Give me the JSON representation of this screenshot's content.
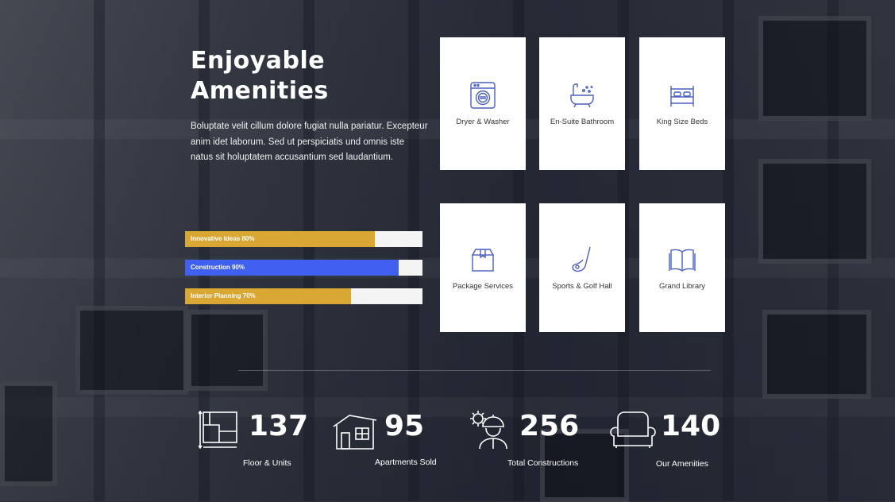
{
  "section": {
    "title_line1": "Enjoyable",
    "title_line2": "Amenities",
    "description": "Boluptate velit cillum dolore fugiat nulla pariatur. Excepteur anim idet laborum. Sed ut perspiciatis und omnis iste natus sit holuptatem accusantium sed laudantium."
  },
  "progress": [
    {
      "label": "Innovative Ideas 80%",
      "value": 0.8,
      "color": "#d9a733"
    },
    {
      "label": "Construction 90%",
      "value": 0.9,
      "color": "#4060f0"
    },
    {
      "label": "Interior Planning 70%",
      "value": 0.7,
      "color": "#d9a733"
    }
  ],
  "amenities": [
    {
      "label": "Dryer & Washer",
      "icon": "washing-machine-icon"
    },
    {
      "label": "En-Suite Bathroom",
      "icon": "bathtub-icon"
    },
    {
      "label": "King Size Beds",
      "icon": "bed-icon"
    },
    {
      "label": "Package Services",
      "icon": "package-box-icon"
    },
    {
      "label": "Sports & Golf Hall",
      "icon": "golf-club-icon"
    },
    {
      "label": "Grand Library",
      "icon": "open-book-icon"
    }
  ],
  "stats": [
    {
      "value": "137",
      "label": "Floor & Units",
      "icon": "floor-plan-icon"
    },
    {
      "value": "95",
      "label": "Apartments Sold",
      "icon": "house-icon"
    },
    {
      "value": "256",
      "label": "Total Constructions",
      "icon": "construction-worker-icon"
    },
    {
      "value": "140",
      "label": "Our Amenities",
      "icon": "armchair-icon"
    }
  ],
  "colors": {
    "accent_gold": "#d9a733",
    "accent_blue": "#4060f0",
    "icon_blue": "#4a5fc1"
  }
}
